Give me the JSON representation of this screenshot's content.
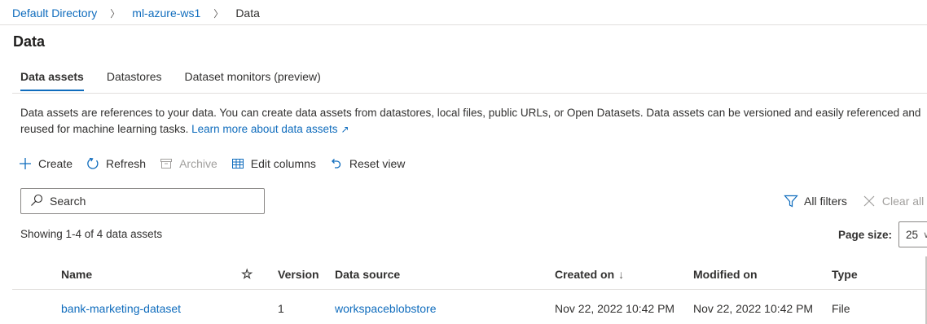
{
  "breadcrumb": {
    "items": [
      "Default Directory",
      "ml-azure-ws1"
    ],
    "current": "Data",
    "separator": "〉"
  },
  "page": {
    "title": "Data"
  },
  "tabs": [
    {
      "label": "Data assets",
      "active": true
    },
    {
      "label": "Datastores",
      "active": false
    },
    {
      "label": "Dataset monitors (preview)",
      "active": false
    }
  ],
  "description": {
    "line1": "Data assets are references to your data. You can create data assets from datastores, local files, public URLs, or Open Datasets. Data assets can be versioned and easily referenced and",
    "line2": "reused for machine learning tasks. ",
    "link": "Learn more about data assets"
  },
  "toolbar": {
    "create": "Create",
    "refresh": "Refresh",
    "archive": "Archive",
    "edit_columns": "Edit columns",
    "reset_view": "Reset view"
  },
  "search": {
    "placeholder": "Search",
    "value": ""
  },
  "filters": {
    "all_filters": "All filters",
    "clear_all": "Clear all"
  },
  "summary": {
    "showing": "Showing 1-4 of 4 data assets"
  },
  "page_size": {
    "label": "Page size:",
    "value": "25"
  },
  "table": {
    "columns": {
      "name": "Name",
      "favorite": "☆",
      "version": "Version",
      "data_source": "Data source",
      "created_on": "Created on",
      "modified_on": "Modified on",
      "type": "Type"
    },
    "sort_indicator": "↓",
    "rows": [
      {
        "name": "bank-marketing-dataset",
        "version": "1",
        "data_source": "workspaceblobstore",
        "created_on": "Nov 22, 2022 10:42 PM",
        "modified_on": "Nov 22, 2022 10:42 PM",
        "type": "File"
      }
    ]
  },
  "colors": {
    "accent": "#0f6cbd",
    "text": "#323130",
    "disabled": "#a19f9d",
    "border": "#e1dfdd"
  }
}
